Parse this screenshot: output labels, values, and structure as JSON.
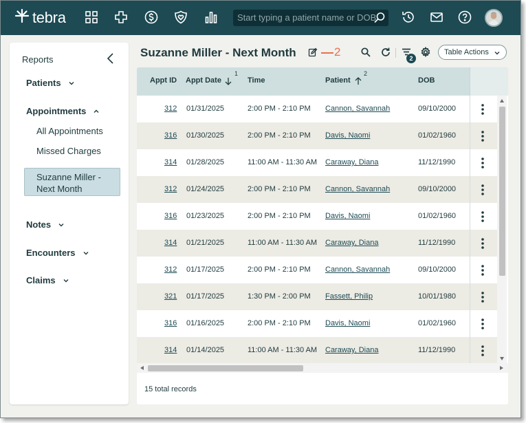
{
  "app": {
    "logo_text": "tebra",
    "search_placeholder": "Start typing a patient name or DOB",
    "nav_icons": [
      "grid-icon",
      "plus-cross-icon",
      "dollar-icon",
      "heart-shield-icon",
      "bar-chart-icon"
    ],
    "right_icons": [
      "history-icon",
      "mail-icon",
      "help-icon"
    ]
  },
  "colors": {
    "topbar": "#1d4a53",
    "accent": "#1d4a53",
    "annotation": "#e8704f",
    "header_row": "#cfdfe0",
    "active_item": "#c9dde2"
  },
  "sidebar": {
    "title": "Reports",
    "sections": [
      {
        "label": "Patients",
        "expanded": false
      },
      {
        "label": "Appointments",
        "expanded": true
      },
      {
        "label": "Notes",
        "expanded": false
      },
      {
        "label": "Encounters",
        "expanded": false
      },
      {
        "label": "Claims",
        "expanded": false
      }
    ],
    "appointments_items": [
      "All Appointments",
      "Missed Charges"
    ],
    "active_item": [
      "Suzanne Miller -",
      "Next Month"
    ]
  },
  "report": {
    "title": "Suzanne Miller - Next Month",
    "annotation_number": "2",
    "filter_count": "2",
    "table_actions_label": "Table Actions"
  },
  "table": {
    "columns": [
      {
        "label": "Appt ID"
      },
      {
        "label": "Appt Date",
        "sort": "desc",
        "sort_order": "1"
      },
      {
        "label": "Time"
      },
      {
        "label": "Patient",
        "sort": "asc",
        "sort_order": "2"
      },
      {
        "label": "DOB"
      }
    ],
    "rows": [
      {
        "id": "312",
        "date": "01/31/2025",
        "time": "2:00 PM - 2:10 PM",
        "patient": "Cannon, Savannah",
        "dob": "09/10/2000"
      },
      {
        "id": "316",
        "date": "01/30/2025",
        "time": "2:00 PM - 2:10 PM",
        "patient": "Davis, Naomi",
        "dob": "01/02/1960"
      },
      {
        "id": "314",
        "date": "01/28/2025",
        "time": "11:00 AM - 11:30 AM",
        "patient": "Caraway, Diana",
        "dob": "11/12/1990"
      },
      {
        "id": "312",
        "date": "01/24/2025",
        "time": "2:00 PM - 2:10 PM",
        "patient": "Cannon, Savannah",
        "dob": "09/10/2000"
      },
      {
        "id": "316",
        "date": "01/23/2025",
        "time": "2:00 PM - 2:10 PM",
        "patient": "Davis, Naomi",
        "dob": "01/02/1960"
      },
      {
        "id": "314",
        "date": "01/21/2025",
        "time": "11:00 AM - 11:30 AM",
        "patient": "Caraway, Diana",
        "dob": "11/12/1990"
      },
      {
        "id": "312",
        "date": "01/17/2025",
        "time": "2:00 PM - 2:10 PM",
        "patient": "Cannon, Savannah",
        "dob": "09/10/2000"
      },
      {
        "id": "321",
        "date": "01/17/2025",
        "time": "1:30 PM - 2:00 PM",
        "patient": "Fassett, Philip",
        "dob": "10/01/1980"
      },
      {
        "id": "316",
        "date": "01/16/2025",
        "time": "2:00 PM - 2:10 PM",
        "patient": "Davis, Naomi",
        "dob": "01/02/1960"
      },
      {
        "id": "314",
        "date": "01/14/2025",
        "time": "11:00 AM - 11:30 AM",
        "patient": "Caraway, Diana",
        "dob": "11/12/1990"
      }
    ],
    "footer": "15 total records"
  }
}
